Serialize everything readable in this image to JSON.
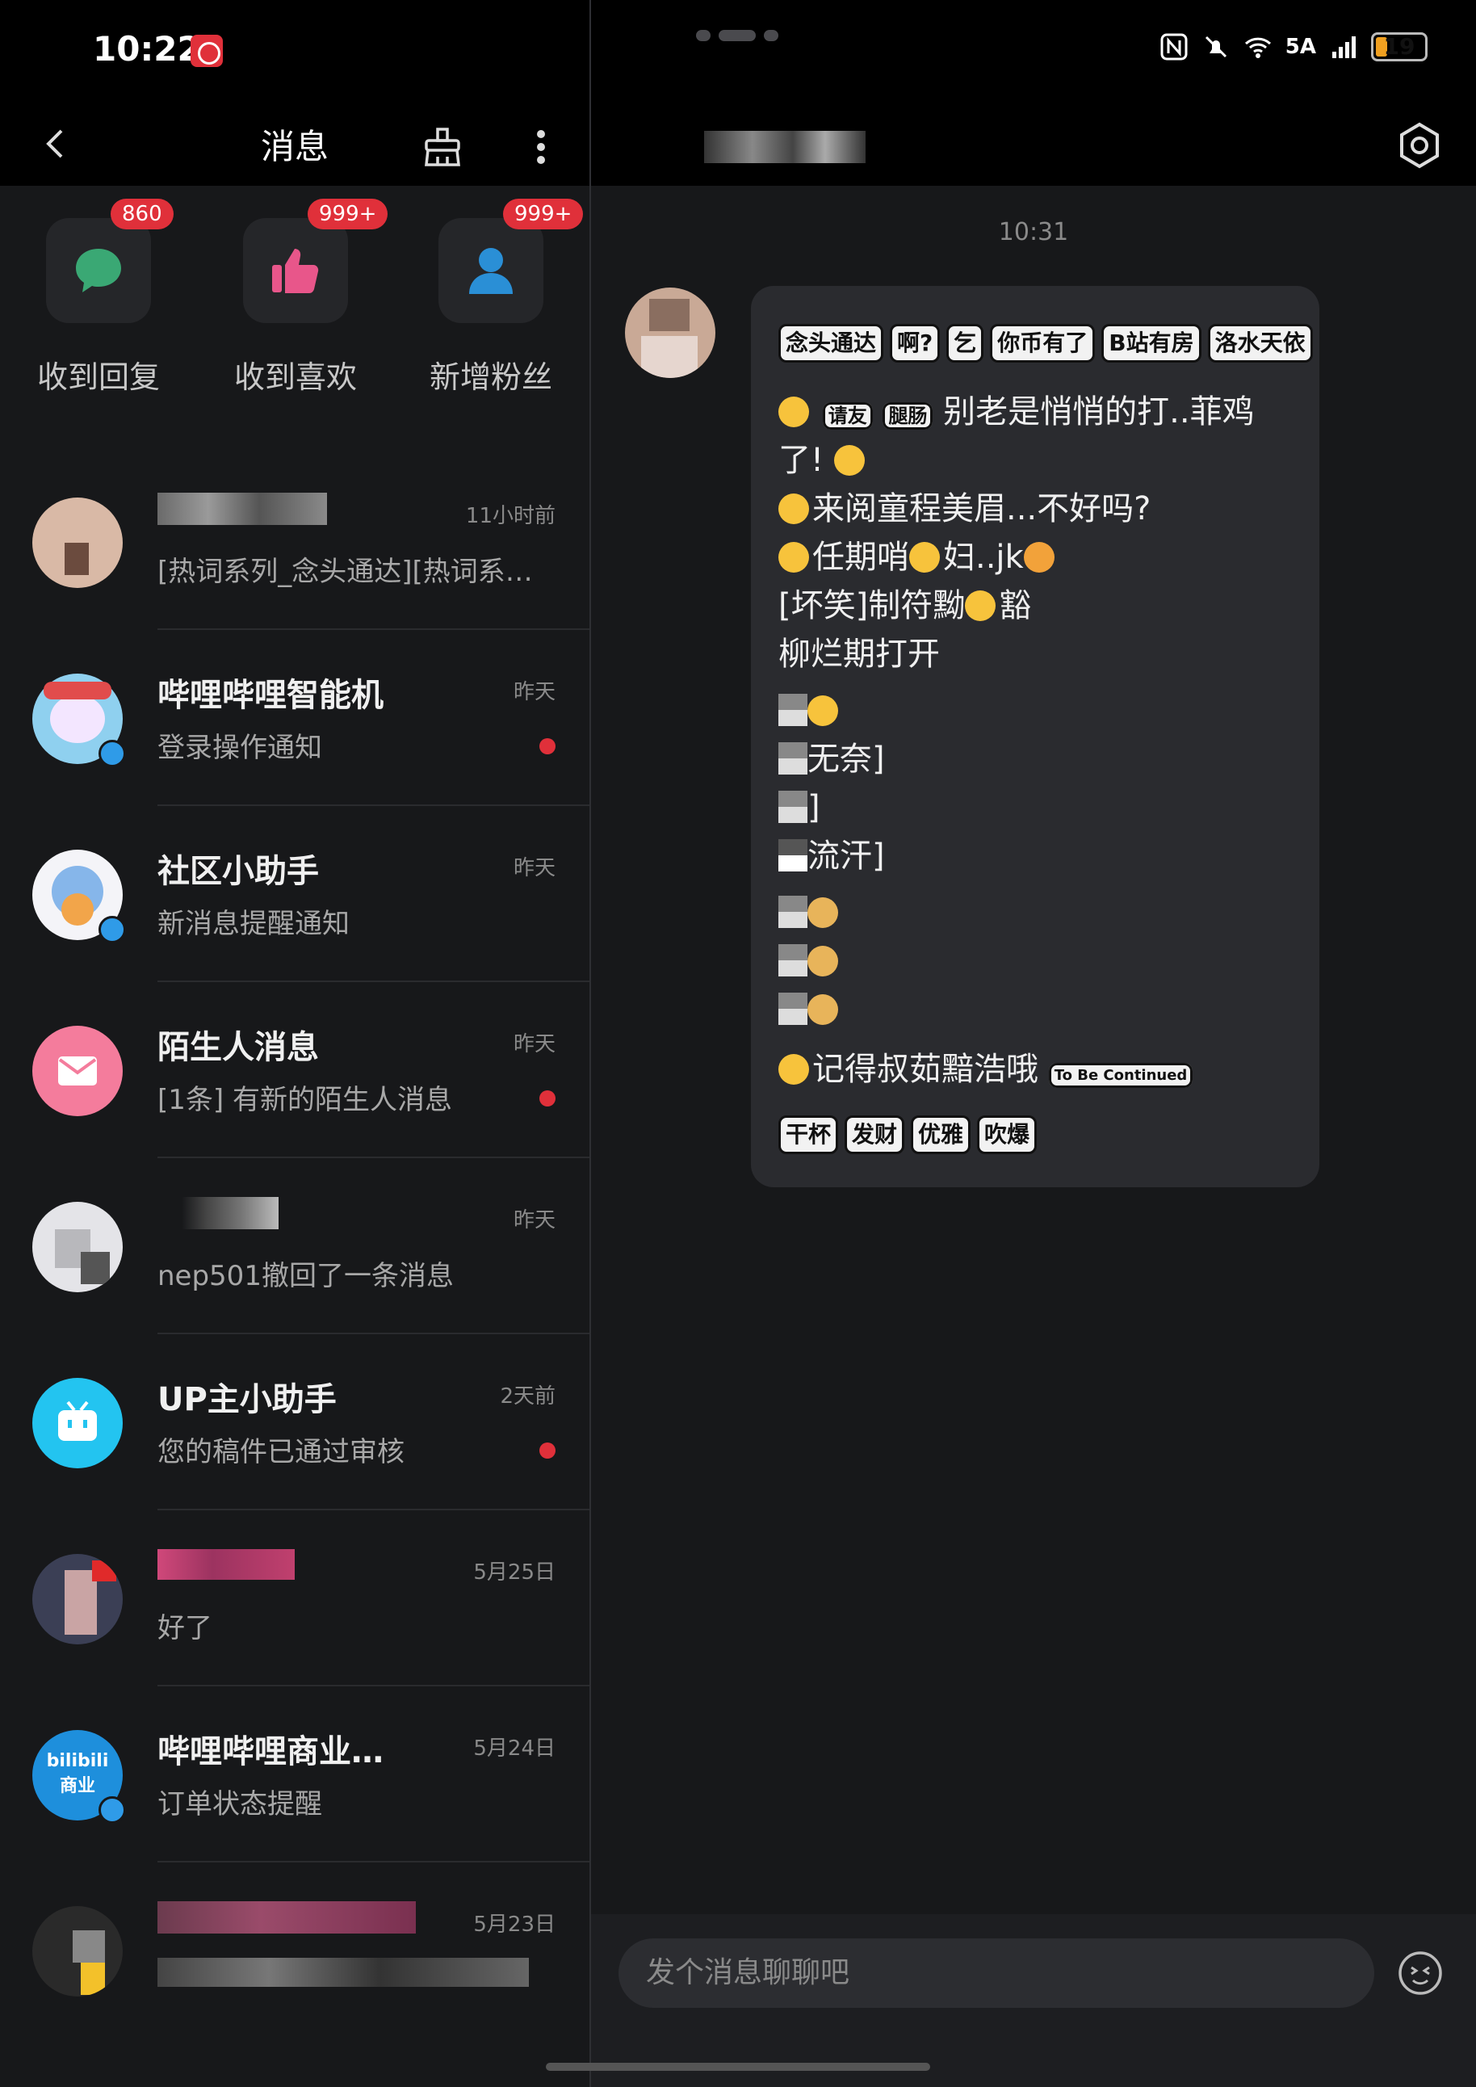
{
  "status_bar": {
    "time": "10:22",
    "battery": "19",
    "net": "5A"
  },
  "left": {
    "title": "消息",
    "categories": [
      {
        "label": "收到回复",
        "badge": "860",
        "icon": "chat-bubble-icon",
        "color": "#3aa874"
      },
      {
        "label": "收到喜欢",
        "badge": "999+",
        "icon": "thumbs-up-icon",
        "color": "#e8568a"
      },
      {
        "label": "新增粉丝",
        "badge": "999+",
        "icon": "person-icon",
        "color": "#2a8fd6"
      }
    ],
    "conversations": [
      {
        "name": "",
        "preview": "[热词系列_念头通达][热词系…",
        "time": "11小时前",
        "unread": false
      },
      {
        "name": "哔哩哔哩智能机",
        "preview": "登录操作通知",
        "time": "昨天",
        "unread": true
      },
      {
        "name": "社区小助手",
        "preview": "新消息提醒通知",
        "time": "昨天",
        "unread": false
      },
      {
        "name": "陌生人消息",
        "preview": "[1条] 有新的陌生人消息",
        "time": "昨天",
        "unread": true
      },
      {
        "name": "",
        "preview": "nep501撤回了一条消息",
        "time": "昨天",
        "unread": false
      },
      {
        "name": "UP主小助手",
        "preview": "您的稿件已通过审核",
        "time": "2天前",
        "unread": true
      },
      {
        "name": "",
        "preview": "好了",
        "time": "5月25日",
        "unread": false
      },
      {
        "name": "哔哩哔哩商业…",
        "preview": "订单状态提醒",
        "time": "5月24日",
        "unread": false
      },
      {
        "name": "",
        "preview": "",
        "time": "5月23日",
        "unread": false
      }
    ]
  },
  "right": {
    "message_time": "10:31",
    "stickers_row1": [
      "念头通达",
      "啊?",
      "乞",
      "你币有了",
      "B站有房",
      "洛水天依"
    ],
    "stickers_row2": [
      "请友",
      "腿肠"
    ],
    "lines": [
      "别老是悄悄的打..菲鸡",
      "了!",
      "来阅童程美眉...不好吗?",
      "任期哨",
      "妇..jk",
      "[坏笑]制符黝",
      "豁",
      "柳烂期打开",
      "无奈]",
      "]",
      "流汗]",
      "记得叔茹黯浩哦"
    ],
    "sticker_tbc": "To Be Continued",
    "stickers_row3": [
      "干杯",
      "发财",
      "优雅",
      "吹爆"
    ],
    "input_placeholder": "发个消息聊聊吧"
  }
}
